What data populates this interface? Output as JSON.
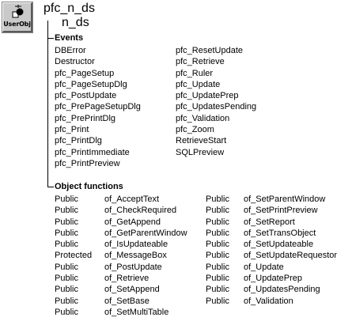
{
  "icon": {
    "label": "UserObj",
    "semantic": "user-object-icon"
  },
  "header": {
    "title": "pfc_n_ds",
    "subtitle": "n_ds"
  },
  "events": {
    "heading": "Events",
    "column1": [
      "DBError",
      "Destructor",
      "pfc_PageSetup",
      "pfc_PageSetupDlg",
      "pfc_PostUpdate",
      "pfc_PrePageSetupDlg",
      "pfc_PrePrintDlg",
      "pfc_Print",
      "pfc_PrintDlg",
      "pfc_PrintImmediate",
      "pfc_PrintPreview"
    ],
    "column2": [
      "pfc_ResetUpdate",
      "pfc_Retrieve",
      "pfc_Ruler",
      "pfc_Update",
      "pfc_UpdatePrep",
      "pfc_UpdatesPending",
      "pfc_Validation",
      "pfc_Zoom",
      "RetrieveStart",
      "SQLPreview"
    ]
  },
  "object_functions": {
    "heading": "Object functions",
    "left_access": [
      "Public",
      "Public",
      "Public",
      "Public",
      "Public",
      "Protected",
      "Public",
      "Public",
      "Public",
      "Public",
      "Public"
    ],
    "left_names": [
      "of_AcceptText",
      "of_CheckRequired",
      "of_GetAppend",
      "of_GetParentWindow",
      "of_IsUpdateable",
      "of_MessageBox",
      "of_PostUpdate",
      "of_Retrieve",
      "of_SetAppend",
      "of_SetBase",
      "of_SetMultiTable"
    ],
    "right_access": [
      "Public",
      "Public",
      "Public",
      "Public",
      "Public",
      "Public",
      "Public",
      "Public",
      "Public",
      "Public"
    ],
    "right_names": [
      "of_SetParentWindow",
      "of_SetPrintPreview",
      "of_SetReport",
      "of_SetTransObject",
      "of_SetUpdateable",
      "of_SetUpdateRequestor",
      "of_Update",
      "of_UpdatePrep",
      "of_UpdatesPending",
      "of_Validation"
    ]
  }
}
